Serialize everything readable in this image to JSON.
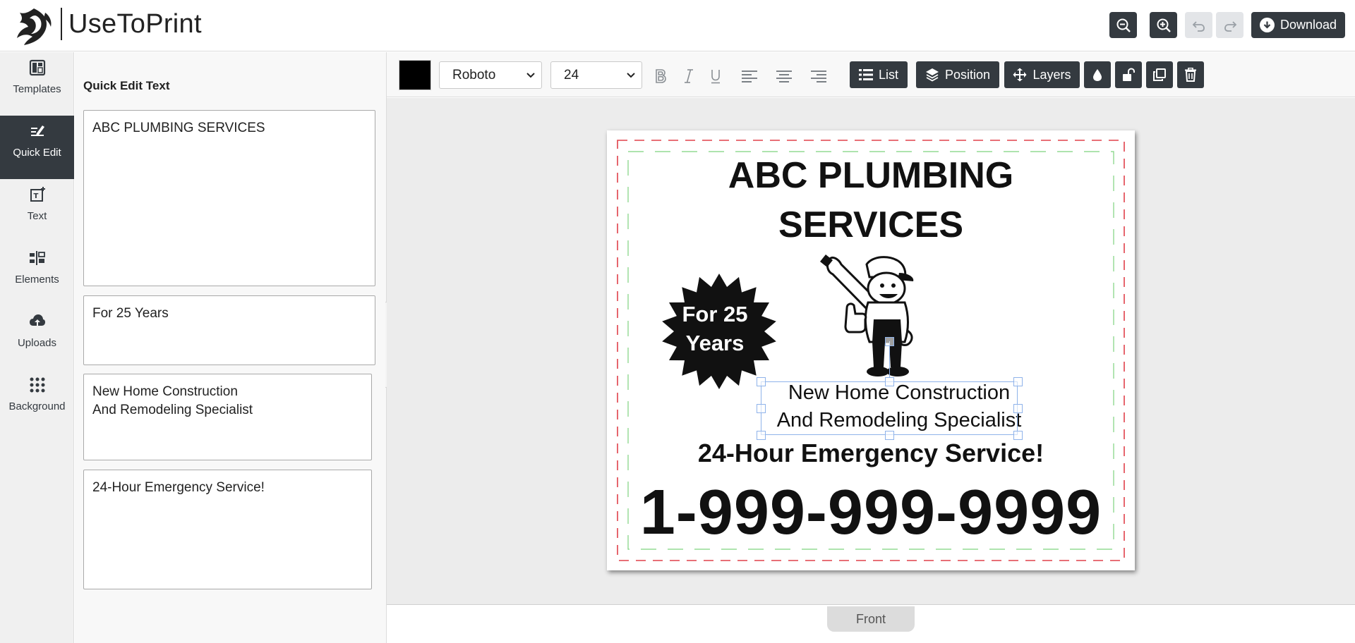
{
  "header": {
    "brand": "UseToPrint",
    "buttons": {
      "zoom_out": "zoom-out-icon",
      "zoom_in": "zoom-in-icon",
      "undo": "undo-icon",
      "redo": "redo-icon",
      "download_label": "Download"
    }
  },
  "sidebar": {
    "items": [
      {
        "label": "Templates",
        "icon": "templates-icon"
      },
      {
        "label": "Quick Edit",
        "icon": "quick-edit-icon",
        "active": true
      },
      {
        "label": "Text",
        "icon": "text-icon"
      },
      {
        "label": "Elements",
        "icon": "elements-icon"
      },
      {
        "label": "Uploads",
        "icon": "upload-icon"
      },
      {
        "label": "Background",
        "icon": "background-icon"
      }
    ]
  },
  "quick_edit": {
    "title": "Quick Edit Text",
    "fields": [
      "ABC PLUMBING SERVICES",
      "For 25 Years",
      "New Home Construction\nAnd Remodeling Specialist",
      "24-Hour Emergency Service!"
    ]
  },
  "toolbar": {
    "text_color": "#000000",
    "font_family": "Roboto",
    "font_size": "24",
    "list_label": "List",
    "position_label": "Position",
    "layers_label": "Layers"
  },
  "canvas": {
    "title_line1": "ABC PLUMBING",
    "title_line2": "SERVICES",
    "badge_line1": "For 25",
    "badge_line2": "Years",
    "specialty_line1": "New Home Construction",
    "specialty_line2": "And Remodeling Specialist",
    "emergency": "24-Hour Emergency Service!",
    "phone": "1-999-999-9999"
  },
  "footer": {
    "tab": "Front"
  }
}
